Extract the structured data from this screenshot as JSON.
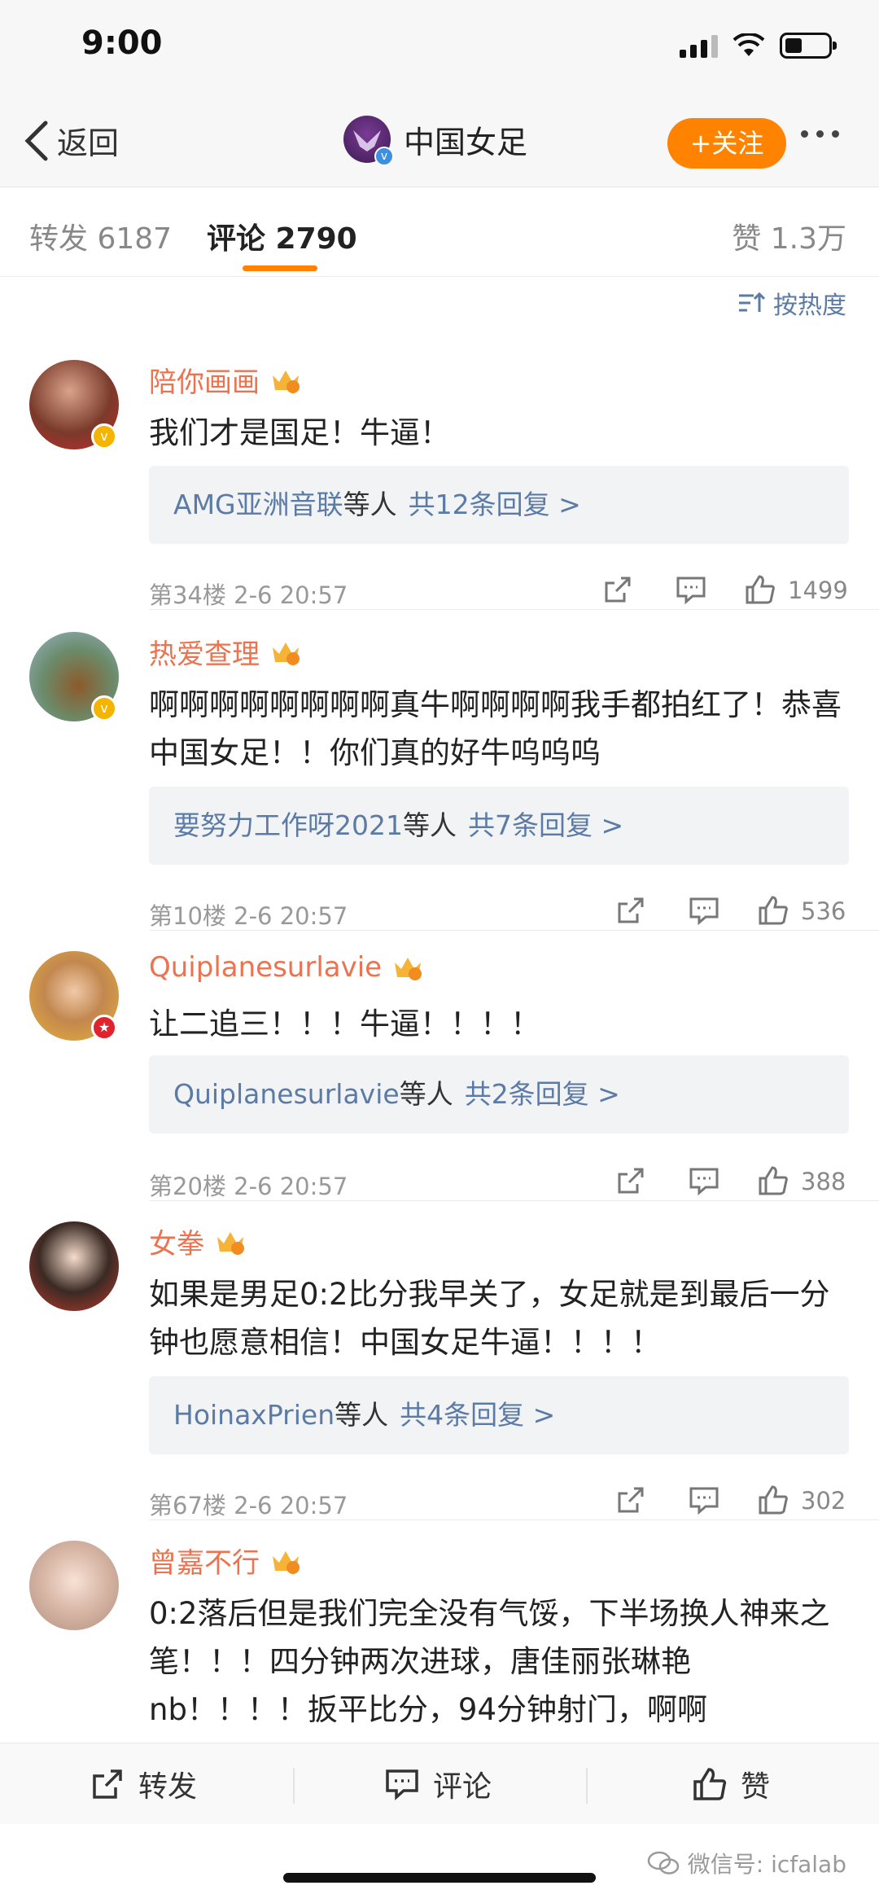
{
  "status_bar": {
    "time": "9:00"
  },
  "nav": {
    "back_label": "返回",
    "title": "中国女足",
    "follow_label": "+关注"
  },
  "tabs": {
    "forward": "转发 6187",
    "comment": "评论 2790",
    "like": "赞 1.3万"
  },
  "sort_label": "按热度",
  "comments": [
    {
      "username": "陪你画画",
      "text": "我们才是国足！牛逼！",
      "reply_names": "AMG亚洲音联",
      "reply_suffix": "等人",
      "reply_count": "共12条回复 >",
      "meta": "第34楼 2-6 20:57",
      "likes": "1499"
    },
    {
      "username": "热爱查理",
      "text": "啊啊啊啊啊啊啊啊真牛啊啊啊啊我手都拍红了！恭喜中国女足！！你们真的好牛呜呜呜",
      "reply_names": "要努力工作呀2021",
      "reply_suffix": "等人",
      "reply_count": "共7条回复 >",
      "meta": "第10楼 2-6 20:57",
      "likes": "536"
    },
    {
      "username": "Quiplanesurlavie",
      "text": "让二追三！！！牛逼！！！！",
      "reply_names": "Quiplanesurlavie",
      "reply_suffix": "等人",
      "reply_count": "共2条回复 >",
      "meta": "第20楼 2-6 20:57",
      "likes": "388"
    },
    {
      "username": "女拳",
      "text": "如果是男足0:2比分我早关了，女足就是到最后一分钟也愿意相信！中国女足牛逼！！！！",
      "reply_names": "HoinaxPrien",
      "reply_suffix": "等人",
      "reply_count": "共4条回复 >",
      "meta": "第67楼 2-6 20:57",
      "likes": "302"
    },
    {
      "username": "曾嘉不行",
      "text": "0:2落后但是我们完全没有气馁，下半场换人神来之笔！！！四分钟两次进球，唐佳丽张琳艳nb！！！！扳平比分，94分钟射门，啊啊"
    }
  ],
  "toolbar": {
    "forward": "转发",
    "comment": "评论",
    "like": "赞"
  },
  "watermark": "微信号: icfalab",
  "colors": {
    "accent": "#ff8200",
    "username": "#eb7350",
    "link": "#5b7ba6"
  }
}
